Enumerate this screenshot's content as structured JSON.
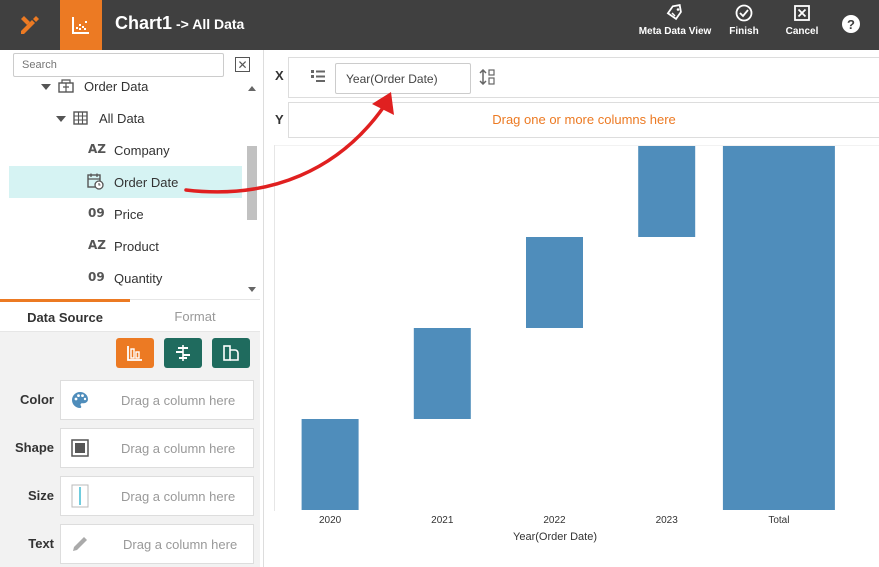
{
  "app": {
    "title": "Chart1",
    "breadcrumb": "-> All Data"
  },
  "toolbar": {
    "meta_data_view": "Meta Data View",
    "finish": "Finish",
    "cancel": "Cancel",
    "help": "?"
  },
  "search": {
    "placeholder": "Search"
  },
  "tree": {
    "items": [
      {
        "label": "Order Data",
        "icon": "cube-icon"
      },
      {
        "label": "All Data",
        "icon": "table-icon"
      },
      {
        "label": "Company",
        "icon_text": "AZ"
      },
      {
        "label": "Order Date",
        "icon": "date-icon"
      },
      {
        "label": "Price",
        "icon_text": "09"
      },
      {
        "label": "Product",
        "icon_text": "AZ"
      },
      {
        "label": "Quantity",
        "icon_text": "09"
      }
    ]
  },
  "tabs": {
    "data_source": "Data Source",
    "format": "Format"
  },
  "fields": {
    "color": {
      "label": "Color",
      "placeholder": "Drag a column here"
    },
    "shape": {
      "label": "Shape",
      "placeholder": "Drag a column here"
    },
    "size": {
      "label": "Size",
      "placeholder": "Drag a column here"
    },
    "text": {
      "label": "Text",
      "placeholder": "Drag a column here"
    }
  },
  "x_axis": {
    "label": "X",
    "pill": "Year(Order Date)"
  },
  "y_axis": {
    "label": "Y",
    "hint": "Drag one or more columns here"
  },
  "colors": {
    "accent": "#ec7a23",
    "bar": "#4f8dbb",
    "topbar": "#404040",
    "teal": "#1f6b5e"
  },
  "chart_data": {
    "type": "bar",
    "subtype": "waterfall",
    "categories": [
      "2020",
      "2021",
      "2022",
      "2023",
      "Total"
    ],
    "series": [
      {
        "start": [
          0,
          1,
          2,
          3,
          0
        ],
        "end": [
          1,
          2,
          3,
          4,
          4
        ]
      }
    ],
    "xlabel": "Year(Order Date)",
    "ylabel": "",
    "ylim": [
      0,
      4
    ],
    "grid": false
  }
}
